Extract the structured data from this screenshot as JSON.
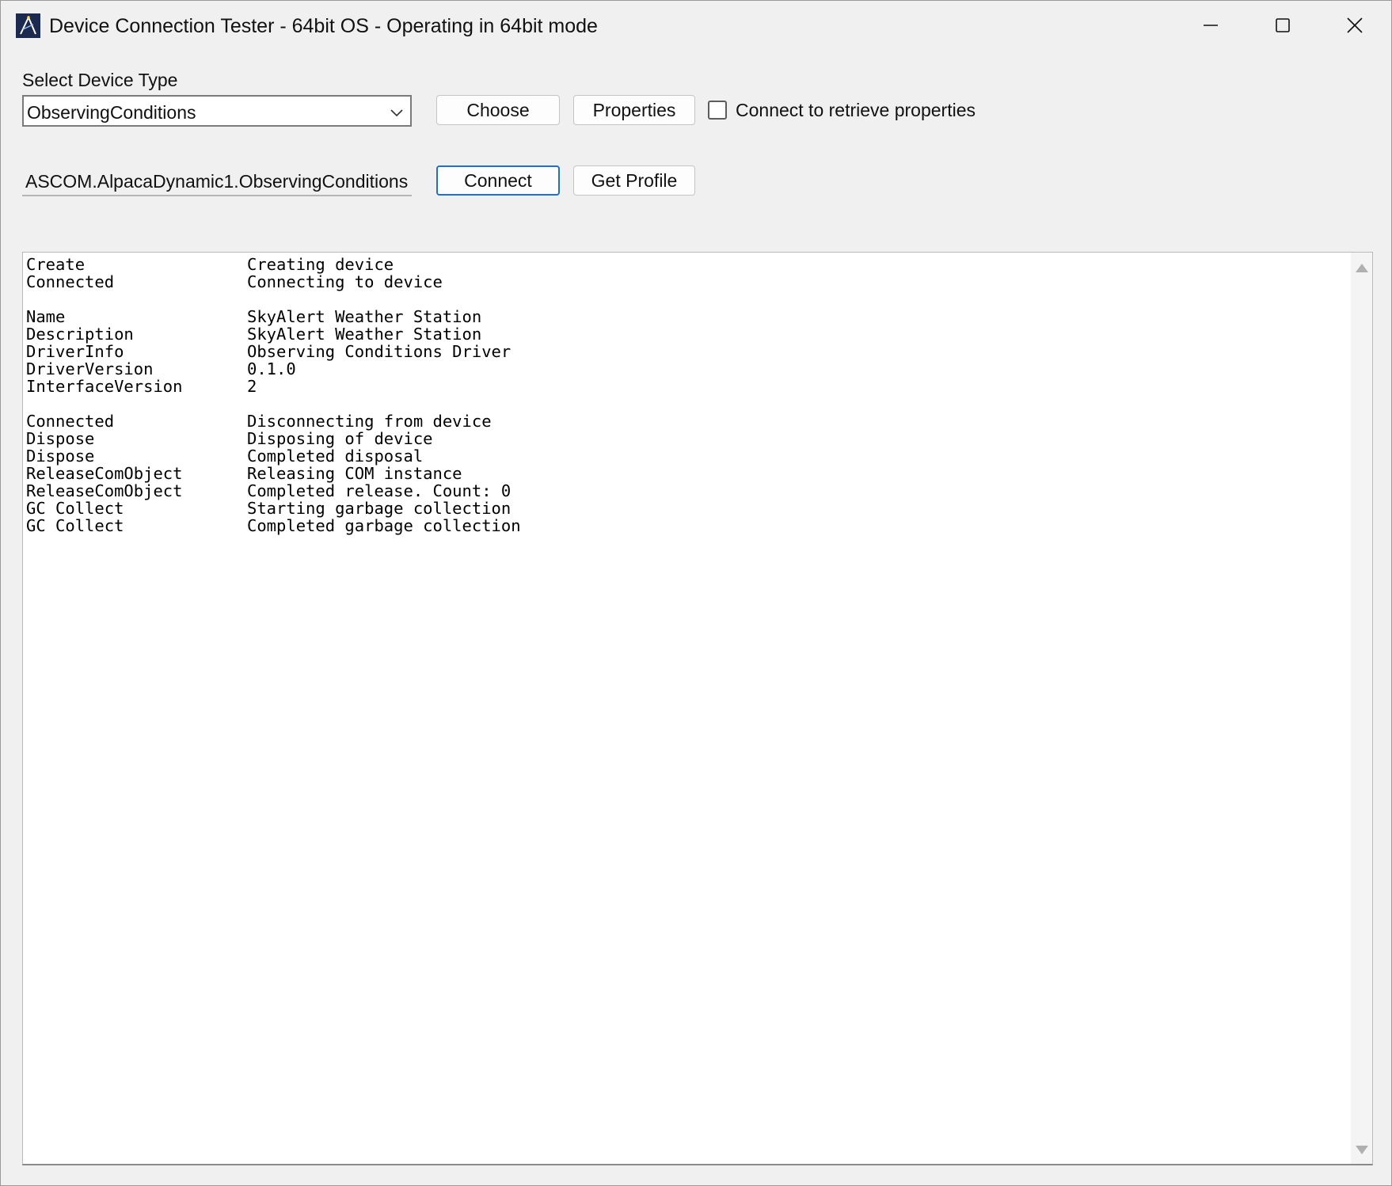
{
  "window": {
    "title": "Device Connection Tester - 64bit OS - Operating in 64bit mode",
    "icon": "ascom-app-icon"
  },
  "device_type": {
    "label": "Select Device Type",
    "selected": "ObservingConditions"
  },
  "buttons": {
    "choose": "Choose",
    "properties": "Properties",
    "connect": "Connect",
    "get_profile": "Get Profile"
  },
  "checkbox": {
    "label": "Connect to retrieve properties",
    "checked": false
  },
  "prog_id": "ASCOM.AlpacaDynamic1.ObservingConditions",
  "log": [
    {
      "key": "Create",
      "value": "Creating device"
    },
    {
      "key": "Connected",
      "value": "Connecting to device"
    },
    {
      "key": "",
      "value": ""
    },
    {
      "key": "Name",
      "value": "SkyAlert Weather Station"
    },
    {
      "key": "Description",
      "value": "SkyAlert Weather Station"
    },
    {
      "key": "DriverInfo",
      "value": "Observing Conditions Driver"
    },
    {
      "key": "DriverVersion",
      "value": "0.1.0"
    },
    {
      "key": "InterfaceVersion",
      "value": "2"
    },
    {
      "key": "",
      "value": ""
    },
    {
      "key": "Connected",
      "value": "Disconnecting from device"
    },
    {
      "key": "Dispose",
      "value": "Disposing of device"
    },
    {
      "key": "Dispose",
      "value": "Completed disposal"
    },
    {
      "key": "ReleaseComObject",
      "value": "Releasing COM instance"
    },
    {
      "key": "ReleaseComObject",
      "value": "Completed release. Count: 0"
    },
    {
      "key": "GC Collect",
      "value": "Starting garbage collection"
    },
    {
      "key": "GC Collect",
      "value": "Completed garbage collection"
    }
  ],
  "colors": {
    "window_bg": "#f0f0f0",
    "focus_border": "#1f6fd1",
    "icon_bg": "#1b2a4e"
  }
}
